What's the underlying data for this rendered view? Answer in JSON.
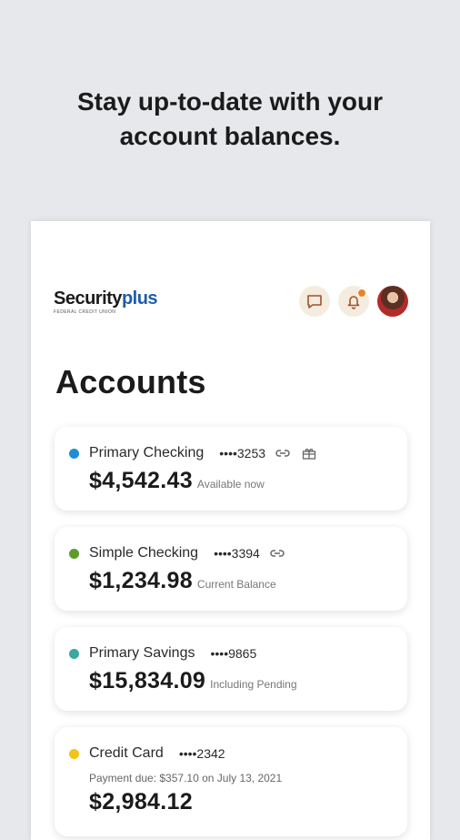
{
  "headline": {
    "line1": "Stay up-to-date with your",
    "line2": "account balances."
  },
  "header": {
    "logo_main": "Security",
    "logo_accent": "plus",
    "logo_sub": "FEDERAL CREDIT UNION",
    "icons": [
      "message-icon",
      "bell-icon",
      "avatar"
    ],
    "notification_dot_color": "#e8842c"
  },
  "page_title": "Accounts",
  "accounts": [
    {
      "name": "Primary Checking",
      "mask": "••••3253",
      "balance": "$4,542.43",
      "balance_label": "Available now",
      "dot_color": "#1e8fd6",
      "icons": [
        "link-icon",
        "gift-icon"
      ]
    },
    {
      "name": "Simple Checking",
      "mask": "••••3394",
      "balance": "$1,234.98",
      "balance_label": "Current Balance",
      "dot_color": "#5e9c2a",
      "icons": [
        "link-icon"
      ]
    },
    {
      "name": "Primary Savings",
      "mask": "••••9865",
      "balance": "$15,834.09",
      "balance_label": "Including Pending",
      "dot_color": "#3aa8a0",
      "icons": []
    },
    {
      "name": "Credit Card",
      "mask": "••••2342",
      "payment_due": "Payment due: $357.10 on July 13, 2021",
      "balance": "$2,984.12",
      "dot_color": "#f2c318",
      "icons": []
    }
  ]
}
